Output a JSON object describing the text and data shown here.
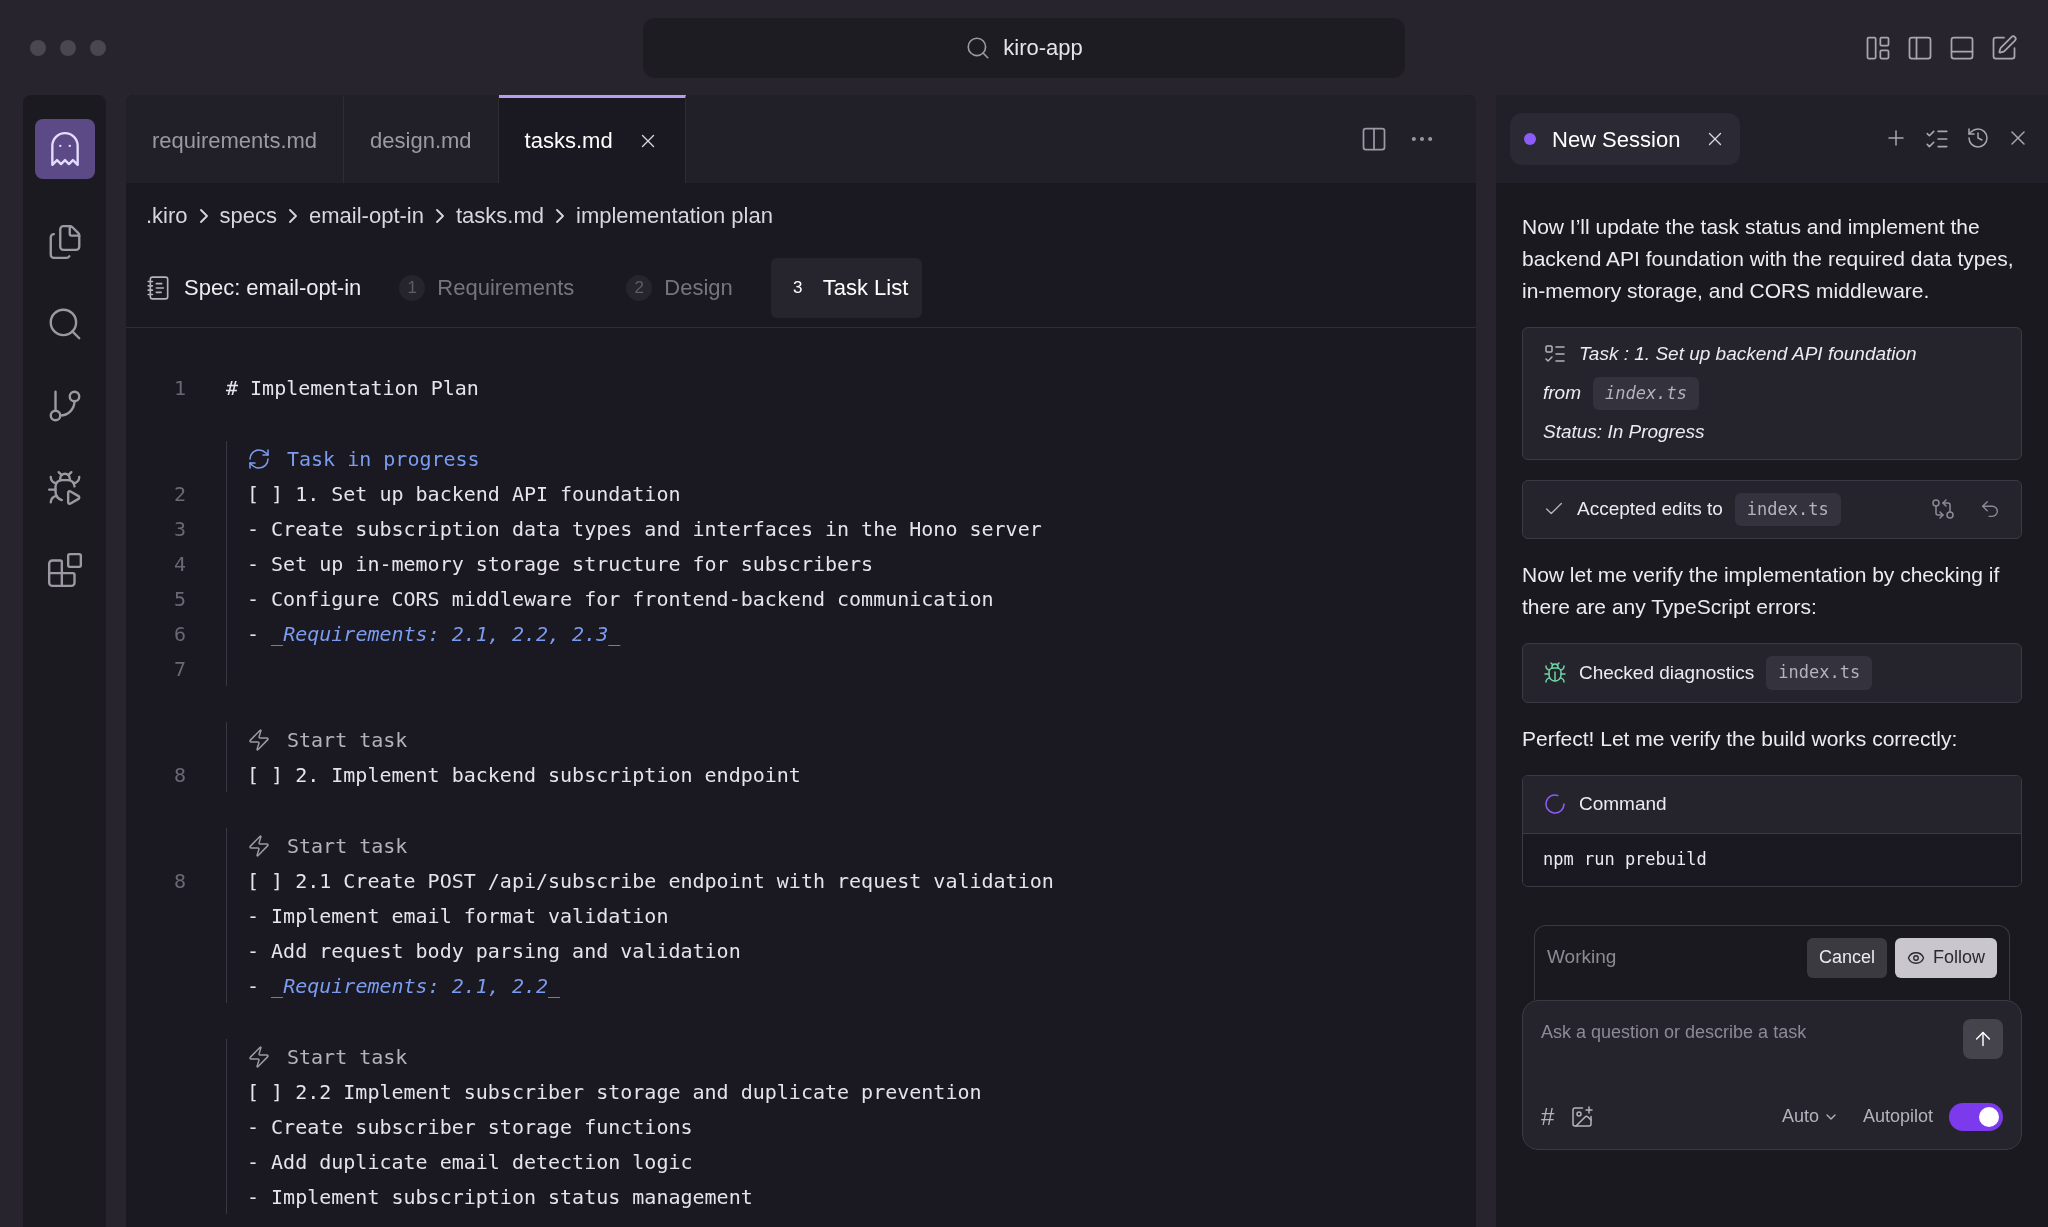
{
  "window": {
    "title": "kiro-app"
  },
  "tabs": [
    {
      "label": "requirements.md",
      "selected": false
    },
    {
      "label": "design.md",
      "selected": false
    },
    {
      "label": "tasks.md",
      "selected": true
    }
  ],
  "breadcrumb": [
    ".kiro",
    "specs",
    "email-opt-in",
    "tasks.md",
    "implementation plan"
  ],
  "spec": {
    "label": "Spec: email-opt-in",
    "steps": [
      {
        "number": "1",
        "label": "Requirements",
        "selected": false
      },
      {
        "number": "2",
        "label": "Design",
        "selected": false
      },
      {
        "number": "3",
        "label": "Task List",
        "selected": true
      }
    ]
  },
  "editor": {
    "heading": {
      "number": "1",
      "text": "# Implementation Plan"
    },
    "groups": [
      {
        "codelens": {
          "kind": "in_progress",
          "label": "Task in progress"
        },
        "lines": [
          {
            "number": "2",
            "text": "[ ] 1. Set up backend API foundation"
          },
          {
            "number": "3",
            "text": "- Create subscription data types and interfaces in the Hono server"
          },
          {
            "number": "4",
            "text": "- Set up in-memory storage structure for subscribers"
          },
          {
            "number": "5",
            "text": "- Configure CORS middleware for frontend-backend communication"
          },
          {
            "number": "6",
            "text": "- ",
            "reference": "_Requirements: 2.1, 2.2, 2.3_"
          },
          {
            "number": "7"
          }
        ]
      },
      {
        "codelens": {
          "kind": "start",
          "label": "Start task"
        },
        "lines": [
          {
            "number": "8",
            "text": "[ ] 2. Implement backend subscription endpoint"
          }
        ]
      },
      {
        "codelens": {
          "kind": "start",
          "label": "Start task"
        },
        "lines": [
          {
            "number": "8",
            "text": "[ ] 2.1 Create POST /api/subscribe endpoint with request validation"
          },
          {
            "text": "- Implement email format validation"
          },
          {
            "text": "- Add request body parsing and validation"
          },
          {
            "text": "- ",
            "reference": "_Requirements: 2.1, 2.2_"
          }
        ]
      },
      {
        "codelens": {
          "kind": "start",
          "label": "Start task"
        },
        "lines": [
          {
            "text": "[ ] 2.2 Implement subscriber storage and duplicate prevention"
          },
          {
            "text": "- Create subscriber storage functions"
          },
          {
            "text": "- Add duplicate email detection logic"
          },
          {
            "text": "- Implement subscription status management"
          }
        ]
      }
    ]
  },
  "chat": {
    "session": {
      "title": "New Session"
    },
    "items": [
      {
        "kind": "message",
        "text": "Now I’ll update the task status and implement the backend API foundation with the required data types, in-memory storage, and CORS middleware."
      },
      {
        "kind": "task",
        "title": "Task : 1. Set up backend API foundation",
        "from": "from",
        "file": "index.ts",
        "status": "Status: In Progress"
      },
      {
        "kind": "accepted",
        "label": "Accepted edits to",
        "file": "index.ts"
      },
      {
        "kind": "message",
        "text": "Now let me verify the implementation by checking if there are any TypeScript errors:"
      },
      {
        "kind": "diagnostics",
        "label": "Checked diagnostics",
        "file": "index.ts"
      },
      {
        "kind": "message",
        "text": "Perfect! Let me verify the build works correctly:"
      },
      {
        "kind": "command",
        "label": "Command",
        "command": "npm run prebuild"
      }
    ],
    "status": {
      "label": "Working",
      "cancel": "Cancel",
      "follow": "Follow"
    },
    "input": {
      "placeholder": "Ask a question or describe a task",
      "hash": "#",
      "mode": "Auto",
      "autopilot": {
        "label": "Autopilot",
        "on": true
      }
    }
  }
}
